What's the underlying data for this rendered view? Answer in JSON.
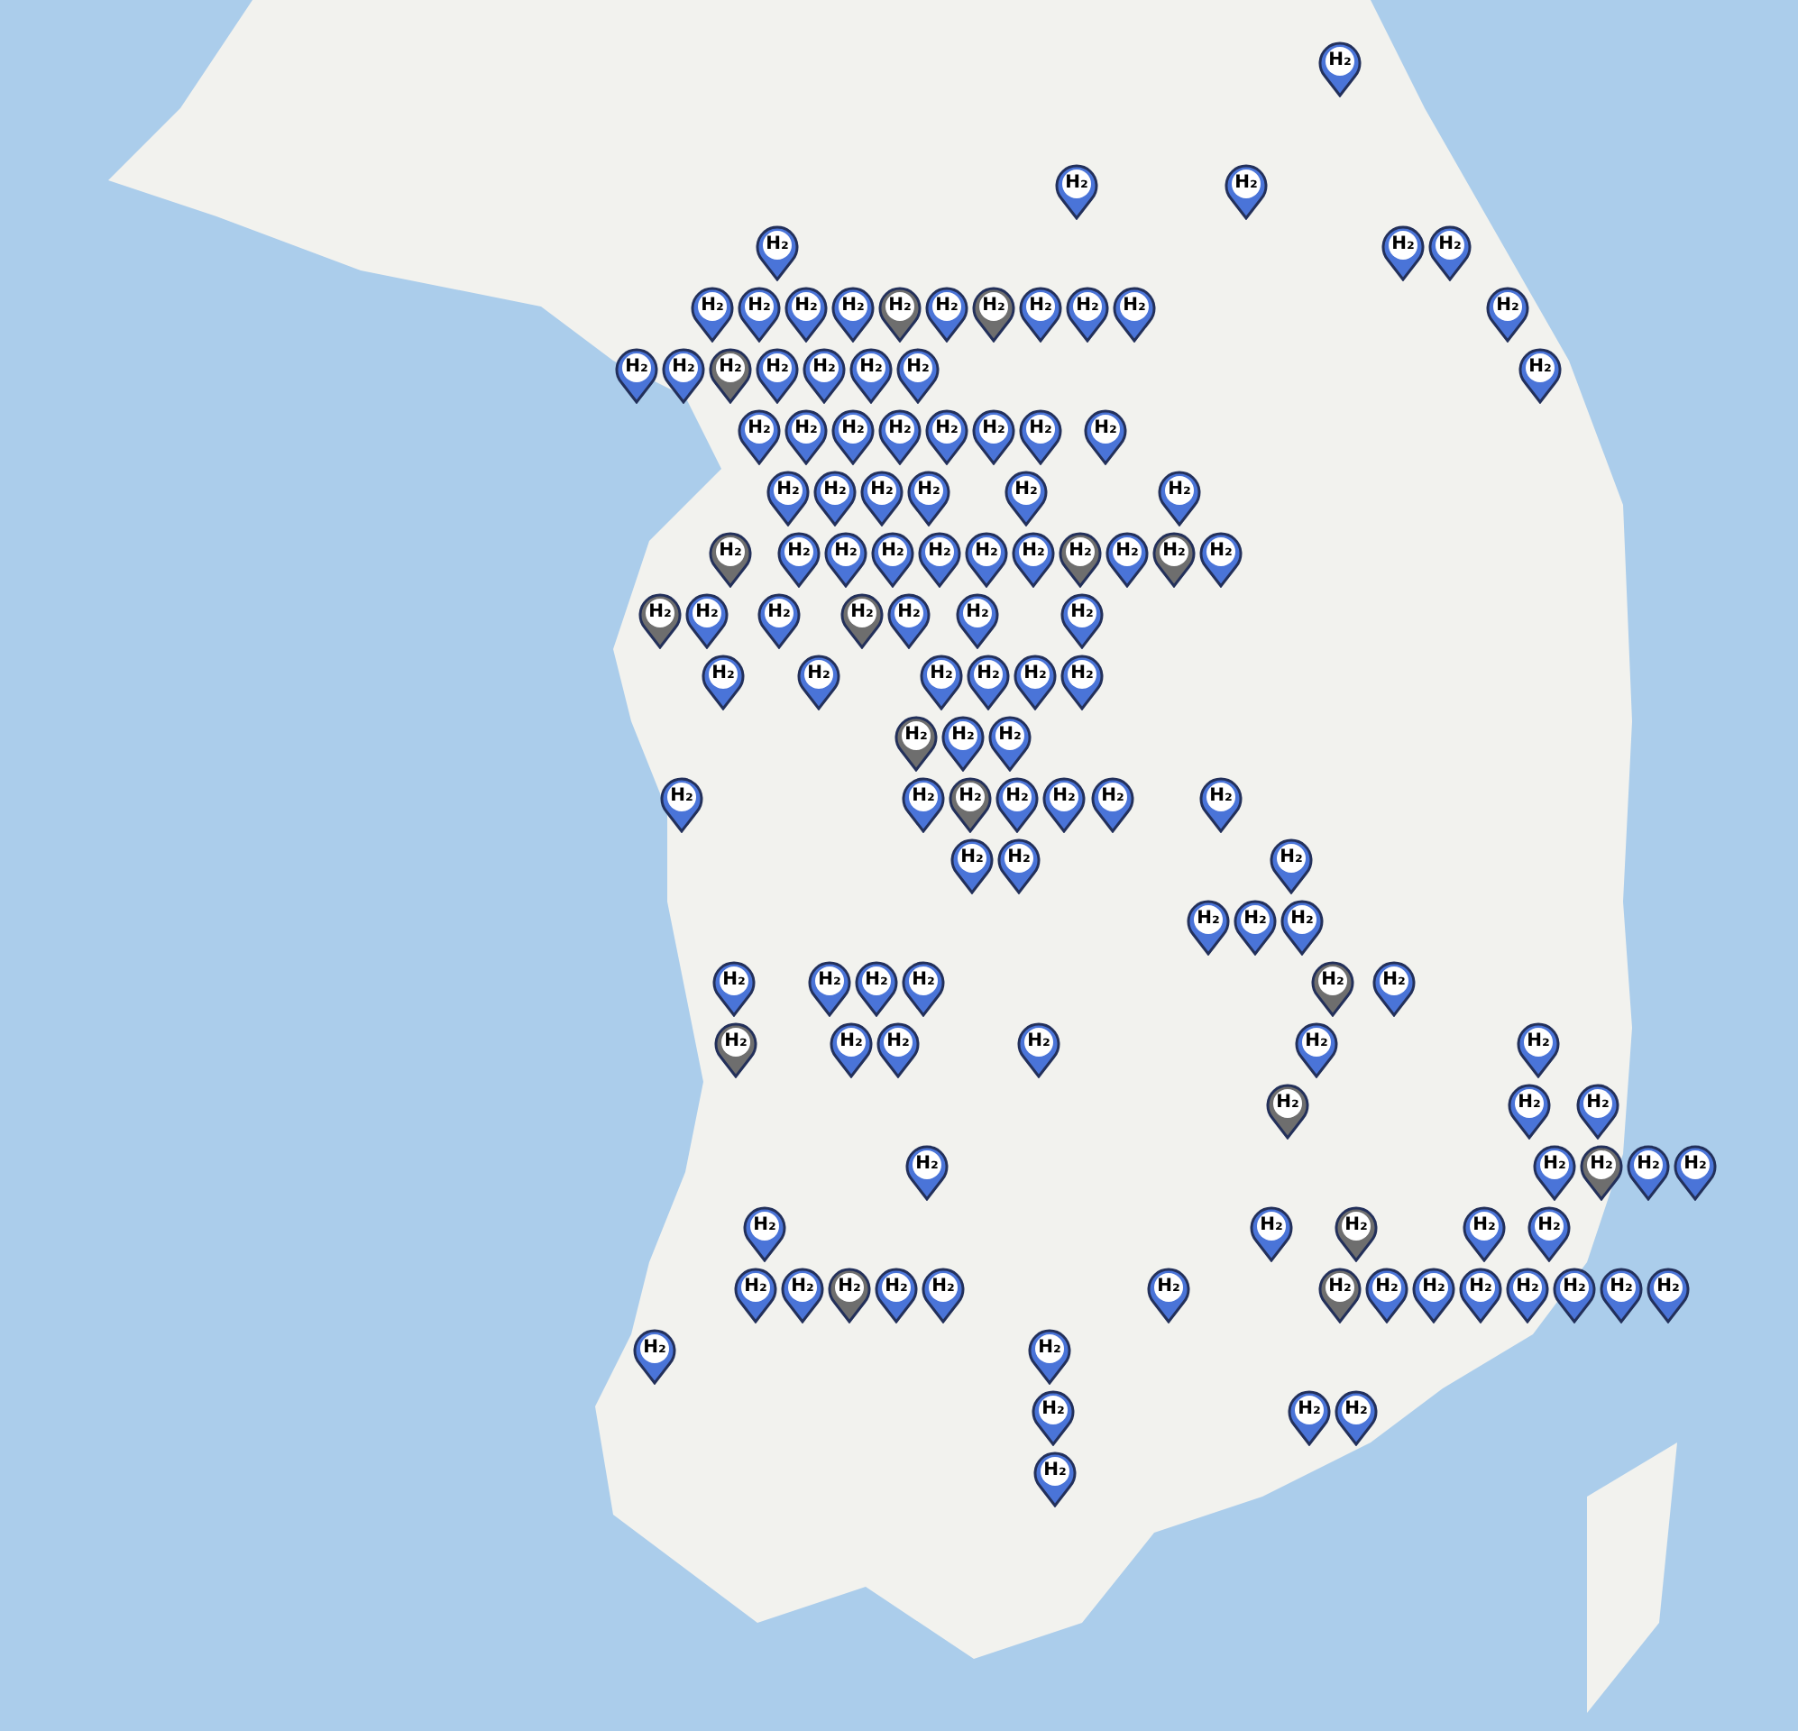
{
  "map": {
    "pins": [
      {
        "label": "H₂",
        "color": "#4a74d8"
      },
      {
        "label": "H₂",
        "color": "#4a74d8"
      },
      {
        "label": "H₂",
        "color": "#4a74d8"
      },
      {
        "label": "H₂",
        "color": "#4a74d8"
      },
      {
        "label": "H₂",
        "color": "#4a74d8"
      },
      {
        "label": "H₂",
        "color": "#4a74d8"
      },
      {
        "label": "H₂",
        "color": "#4a74d8"
      },
      {
        "label": "H₂",
        "color": "#4a74d8"
      },
      {
        "label": "H₂",
        "color": "#4a74d8"
      },
      {
        "label": "H₂",
        "color": "#4a74d8"
      },
      {
        "label": "H₂",
        "color": "#6e6e6e"
      },
      {
        "label": "H₂",
        "color": "#4a74d8"
      },
      {
        "label": "H₂",
        "color": "#6e6e6e"
      },
      {
        "label": "H₂",
        "color": "#4a74d8"
      },
      {
        "label": "H₂",
        "color": "#4a74d8"
      },
      {
        "label": "H₂",
        "color": "#4a74d8"
      },
      {
        "label": "H₂",
        "color": "#4a74d8"
      },
      {
        "label": "H₂",
        "color": "#4a74d8"
      },
      {
        "label": "H₂",
        "color": "#4a74d8"
      },
      {
        "label": "H₂",
        "color": "#6e6e6e"
      },
      {
        "label": "H₂",
        "color": "#4a74d8"
      },
      {
        "label": "H₂",
        "color": "#4a74d8"
      },
      {
        "label": "H₂",
        "color": "#4a74d8"
      },
      {
        "label": "H₂",
        "color": "#4a74d8"
      },
      {
        "label": "H₂",
        "color": "#4a74d8"
      },
      {
        "label": "H₂",
        "color": "#4a74d8"
      },
      {
        "label": "H₂",
        "color": "#4a74d8"
      },
      {
        "label": "H₂",
        "color": "#4a74d8"
      },
      {
        "label": "H₂",
        "color": "#4a74d8"
      },
      {
        "label": "H₂",
        "color": "#4a74d8"
      },
      {
        "label": "H₂",
        "color": "#4a74d8"
      },
      {
        "label": "H₂",
        "color": "#4a74d8"
      },
      {
        "label": "H₂",
        "color": "#4a74d8"
      },
      {
        "label": "H₂",
        "color": "#4a74d8"
      },
      {
        "label": "H₂",
        "color": "#4a74d8"
      },
      {
        "label": "H₂",
        "color": "#4a74d8"
      },
      {
        "label": "H₂",
        "color": "#4a74d8"
      },
      {
        "label": "H₂",
        "color": "#4a74d8"
      },
      {
        "label": "H₂",
        "color": "#4a74d8"
      },
      {
        "label": "H₂",
        "color": "#6e6e6e"
      },
      {
        "label": "H₂",
        "color": "#4a74d8"
      },
      {
        "label": "H₂",
        "color": "#4a74d8"
      },
      {
        "label": "H₂",
        "color": "#4a74d8"
      },
      {
        "label": "H₂",
        "color": "#4a74d8"
      },
      {
        "label": "H₂",
        "color": "#4a74d8"
      },
      {
        "label": "H₂",
        "color": "#4a74d8"
      },
      {
        "label": "H₂",
        "color": "#6e6e6e"
      },
      {
        "label": "H₂",
        "color": "#4a74d8"
      },
      {
        "label": "H₂",
        "color": "#6e6e6e"
      },
      {
        "label": "H₂",
        "color": "#4a74d8"
      },
      {
        "label": "H₂",
        "color": "#6e6e6e"
      },
      {
        "label": "H₂",
        "color": "#4a74d8"
      },
      {
        "label": "H₂",
        "color": "#4a74d8"
      },
      {
        "label": "H₂",
        "color": "#6e6e6e"
      },
      {
        "label": "H₂",
        "color": "#4a74d8"
      },
      {
        "label": "H₂",
        "color": "#4a74d8"
      },
      {
        "label": "H₂",
        "color": "#4a74d8"
      },
      {
        "label": "H₂",
        "color": "#4a74d8"
      },
      {
        "label": "H₂",
        "color": "#4a74d8"
      },
      {
        "label": "H₂",
        "color": "#4a74d8"
      },
      {
        "label": "H₂",
        "color": "#4a74d8"
      },
      {
        "label": "H₂",
        "color": "#4a74d8"
      },
      {
        "label": "H₂",
        "color": "#4a74d8"
      },
      {
        "label": "H₂",
        "color": "#6e6e6e"
      },
      {
        "label": "H₂",
        "color": "#4a74d8"
      },
      {
        "label": "H₂",
        "color": "#4a74d8"
      },
      {
        "label": "H₂",
        "color": "#4a74d8"
      },
      {
        "label": "H₂",
        "color": "#4a74d8"
      },
      {
        "label": "H₂",
        "color": "#6e6e6e"
      },
      {
        "label": "H₂",
        "color": "#4a74d8"
      },
      {
        "label": "H₂",
        "color": "#4a74d8"
      },
      {
        "label": "H₂",
        "color": "#4a74d8"
      },
      {
        "label": "H₂",
        "color": "#4a74d8"
      },
      {
        "label": "H₂",
        "color": "#4a74d8"
      },
      {
        "label": "H₂",
        "color": "#4a74d8"
      },
      {
        "label": "H₂",
        "color": "#4a74d8"
      },
      {
        "label": "H₂",
        "color": "#4a74d8"
      },
      {
        "label": "H₂",
        "color": "#4a74d8"
      },
      {
        "label": "H₂",
        "color": "#4a74d8"
      },
      {
        "label": "H₂",
        "color": "#4a74d8"
      },
      {
        "label": "H₂",
        "color": "#4a74d8"
      },
      {
        "label": "H₂",
        "color": "#4a74d8"
      },
      {
        "label": "H₂",
        "color": "#4a74d8"
      },
      {
        "label": "H₂",
        "color": "#6e6e6e"
      },
      {
        "label": "H₂",
        "color": "#4a74d8"
      },
      {
        "label": "H₂",
        "color": "#6e6e6e"
      },
      {
        "label": "H₂",
        "color": "#4a74d8"
      },
      {
        "label": "H₂",
        "color": "#4a74d8"
      },
      {
        "label": "H₂",
        "color": "#4a74d8"
      },
      {
        "label": "H₂",
        "color": "#4a74d8"
      },
      {
        "label": "H₂",
        "color": "#4a74d8"
      },
      {
        "label": "H₂",
        "color": "#6e6e6e"
      },
      {
        "label": "H₂",
        "color": "#4a74d8"
      },
      {
        "label": "H₂",
        "color": "#4a74d8"
      },
      {
        "label": "H₂",
        "color": "#4a74d8"
      },
      {
        "label": "H₂",
        "color": "#4a74d8"
      },
      {
        "label": "H₂",
        "color": "#6e6e6e"
      },
      {
        "label": "H₂",
        "color": "#4a74d8"
      },
      {
        "label": "H₂",
        "color": "#4a74d8"
      },
      {
        "label": "H₂",
        "color": "#4a74d8"
      },
      {
        "label": "H₂",
        "color": "#4a74d8"
      },
      {
        "label": "H₂",
        "color": "#6e6e6e"
      },
      {
        "label": "H₂",
        "color": "#4a74d8"
      },
      {
        "label": "H₂",
        "color": "#4a74d8"
      },
      {
        "label": "H₂",
        "color": "#4a74d8"
      },
      {
        "label": "H₂",
        "color": "#4a74d8"
      },
      {
        "label": "H₂",
        "color": "#6e6e6e"
      },
      {
        "label": "H₂",
        "color": "#4a74d8"
      },
      {
        "label": "H₂",
        "color": "#4a74d8"
      },
      {
        "label": "H₂",
        "color": "#4a74d8"
      },
      {
        "label": "H₂",
        "color": "#6e6e6e"
      },
      {
        "label": "H₂",
        "color": "#4a74d8"
      },
      {
        "label": "H₂",
        "color": "#4a74d8"
      },
      {
        "label": "H₂",
        "color": "#4a74d8"
      },
      {
        "label": "H₂",
        "color": "#4a74d8"
      },
      {
        "label": "H₂",
        "color": "#4a74d8"
      },
      {
        "label": "H₂",
        "color": "#4a74d8"
      },
      {
        "label": "H₂",
        "color": "#4a74d8"
      },
      {
        "label": "H₂",
        "color": "#4a74d8"
      },
      {
        "label": "H₂",
        "color": "#4a74d8"
      },
      {
        "label": "H₂",
        "color": "#4a74d8"
      },
      {
        "label": "H₂",
        "color": "#4a74d8"
      },
      {
        "label": "H₂",
        "color": "#4a74d8"
      },
      {
        "label": "H₂",
        "color": "#4a74d8"
      }
    ]
  }
}
